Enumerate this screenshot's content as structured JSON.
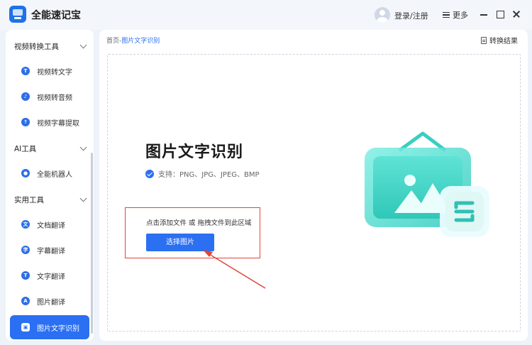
{
  "app": {
    "title": "全能速记宝",
    "login_label": "登录/注册",
    "more_label": "更多"
  },
  "sidebar": {
    "categories": [
      {
        "label": "视频转换工具"
      },
      {
        "label": "AI工具"
      },
      {
        "label": "实用工具"
      }
    ],
    "items": [
      {
        "label": "视频转文字",
        "icon": "T"
      },
      {
        "label": "视频转音频",
        "icon": "♪"
      },
      {
        "label": "视频字幕提取",
        "icon": "↑"
      },
      {
        "label": "全能机器人",
        "icon": "●"
      },
      {
        "label": "文档翻译",
        "icon": "文"
      },
      {
        "label": "字幕翻译",
        "icon": "字"
      },
      {
        "label": "文字翻译",
        "icon": "T"
      },
      {
        "label": "图片翻译",
        "icon": "A"
      },
      {
        "label": "图片文字识别",
        "icon": "▣"
      }
    ]
  },
  "main": {
    "breadcrumb_home": "首页",
    "breadcrumb_sep": "-",
    "breadcrumb_current": "图片文字识别",
    "result_label": "转换结果",
    "title": "图片文字识别",
    "support_text": "支持：PNG、JPG、JPEG、BMP",
    "drop_hint": "点击添加文件 或 拖拽文件到此区域",
    "select_button": "选择图片"
  },
  "colors": {
    "accent": "#2b6ff3",
    "highlight_box": "#e0463a",
    "illustration_teal": "#34d6c8"
  }
}
